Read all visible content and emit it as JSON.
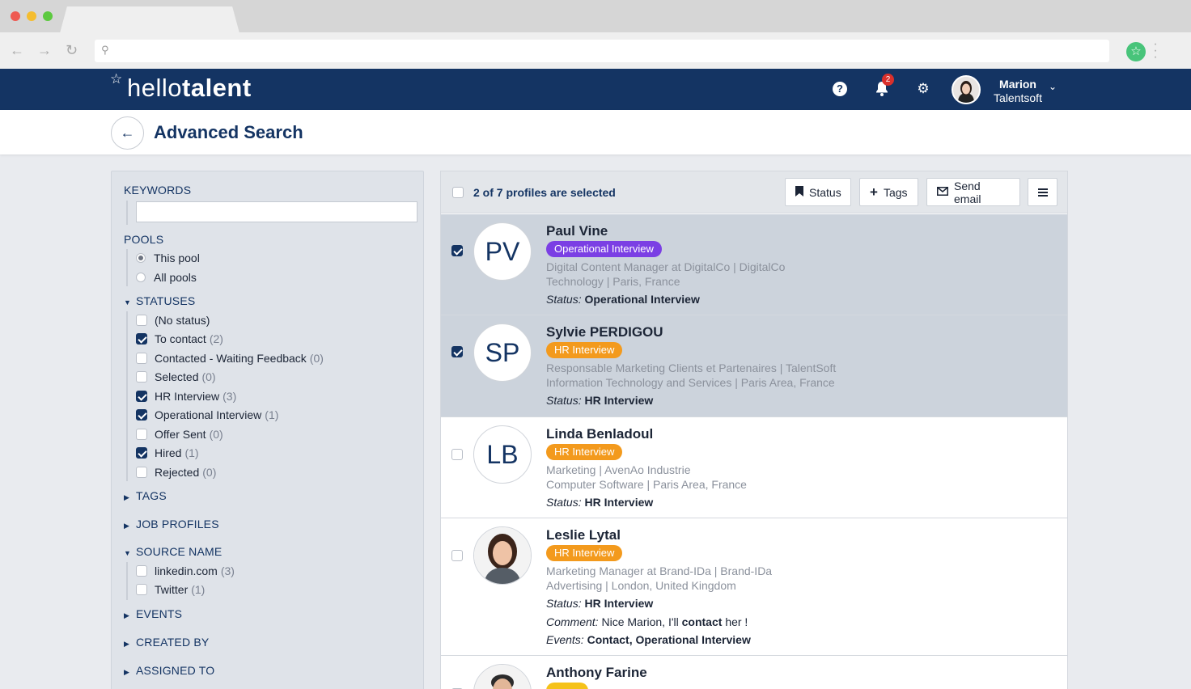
{
  "app": {
    "logo_thin": "hello",
    "logo_bold": "talent",
    "notifications_count": "2",
    "user_first": "Marion",
    "user_company": "Talentsoft"
  },
  "page": {
    "title": "Advanced Search"
  },
  "filters": {
    "keywords_label": "KEYWORDS",
    "pools_label": "POOLS",
    "pools": [
      {
        "label": "This pool",
        "selected": true
      },
      {
        "label": "All pools",
        "selected": false
      }
    ],
    "statuses_label": "STATUSES",
    "statuses": [
      {
        "label": "(No status)",
        "count": "",
        "checked": false
      },
      {
        "label": "To contact",
        "count": "(2)",
        "checked": true
      },
      {
        "label": "Contacted - Waiting Feedback",
        "count": "(0)",
        "checked": false
      },
      {
        "label": "Selected",
        "count": "(0)",
        "checked": false
      },
      {
        "label": "HR Interview",
        "count": "(3)",
        "checked": true
      },
      {
        "label": "Operational Interview",
        "count": "(1)",
        "checked": true
      },
      {
        "label": "Offer Sent",
        "count": "(0)",
        "checked": false
      },
      {
        "label": "Hired",
        "count": "(1)",
        "checked": true
      },
      {
        "label": "Rejected",
        "count": "(0)",
        "checked": false
      }
    ],
    "tags_label": "TAGS",
    "job_profiles_label": "JOB PROFILES",
    "source_name_label": "SOURCE NAME",
    "sources": [
      {
        "label": "linkedin.com",
        "count": "(3)",
        "checked": false
      },
      {
        "label": "Twitter",
        "count": "(1)",
        "checked": false
      }
    ],
    "events_label": "EVENTS",
    "created_by_label": "CREATED BY",
    "assigned_to_label": "ASSIGNED TO"
  },
  "results": {
    "selection_text": "2 of 7 profiles are selected",
    "buttons": {
      "status": "Status",
      "tags": "Tags",
      "send_email": "Send email"
    },
    "status_prefix": "Status:",
    "comment_prefix": "Comment:",
    "events_prefix": "Events:",
    "profiles": [
      {
        "initials": "PV",
        "name": "Paul Vine",
        "badge": "Operational Interview",
        "badge_color": "#7b3fe4",
        "meta1": "Digital Content Manager at DigitalCo  |  DigitalCo",
        "meta2": "Technology  |  Paris, France",
        "status": "Operational Interview",
        "selected": true
      },
      {
        "initials": "SP",
        "name": "Sylvie PERDIGOU",
        "badge": "HR Interview",
        "badge_color": "#f39a1d",
        "meta1": "Responsable Marketing Clients et Partenaires  |  TalentSoft",
        "meta2": "Information Technology and Services  |  Paris Area, France",
        "status": "HR Interview",
        "selected": true
      },
      {
        "initials": "LB",
        "name": "Linda Benladoul",
        "badge": "HR Interview",
        "badge_color": "#f39a1d",
        "meta1": "Marketing  |  AvenAo Industrie",
        "meta2": "Computer Software  |  Paris Area, France",
        "status": "HR Interview",
        "selected": false
      },
      {
        "initials": "",
        "name": "Leslie Lytal",
        "badge": "HR Interview",
        "badge_color": "#f39a1d",
        "meta1": "Marketing Manager at Brand-IDa  |  Brand-IDa",
        "meta2": "Advertising  |  London, United Kingdom",
        "status": "HR Interview",
        "comment_a": "Nice Marion, I'll",
        "comment_b": "contact",
        "comment_c": "her !",
        "events": "Contact, Operational Interview",
        "selected": false
      },
      {
        "initials": "",
        "name": "Anthony Farine",
        "selected": false
      }
    ]
  }
}
